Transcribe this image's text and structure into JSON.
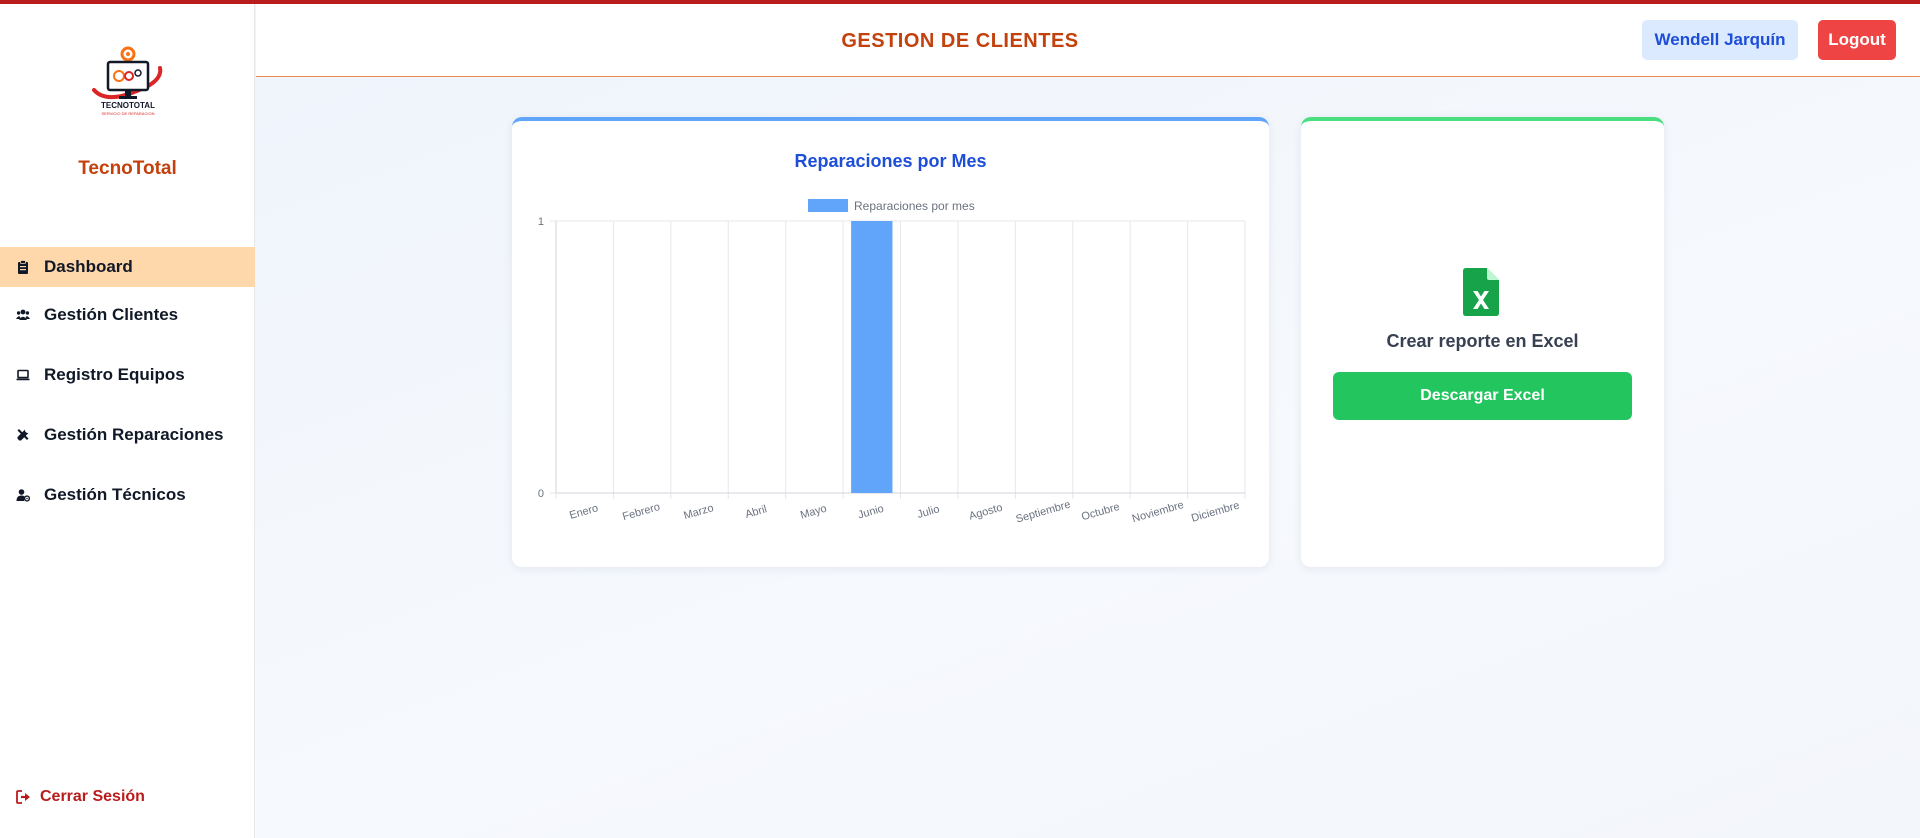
{
  "app": {
    "brand_name": "TecnoTotal",
    "logo_text": "TECNOTOTAL",
    "logo_subtext": "SERVICIO DE REPARACION"
  },
  "header": {
    "title": "GESTION DE CLIENTES",
    "user_name": "Wendell Jarquín",
    "logout_label": "Logout"
  },
  "sidebar": {
    "items": [
      {
        "label": "Dashboard",
        "icon": "clipboard-icon",
        "active": true
      },
      {
        "label": "Gestión Clientes",
        "icon": "users-icon",
        "active": false
      },
      {
        "label": "Registro Equipos",
        "icon": "laptop-icon",
        "active": false
      },
      {
        "label": "Gestión Reparaciones",
        "icon": "tools-icon",
        "active": false
      },
      {
        "label": "Gestión Técnicos",
        "icon": "user-gear-icon",
        "active": false
      }
    ],
    "logout_label": "Cerrar Sesión"
  },
  "chart_card": {
    "title": "Reparaciones por Mes"
  },
  "chart_data": {
    "type": "bar",
    "title": "Reparaciones por Mes",
    "categories": [
      "Enero",
      "Febrero",
      "Marzo",
      "Abril",
      "Mayo",
      "Junio",
      "Julio",
      "Agosto",
      "Septiembre",
      "Octubre",
      "Noviembre",
      "Diciembre"
    ],
    "series": [
      {
        "name": "Reparaciones por mes",
        "values": [
          0,
          0,
          0,
          0,
          0,
          1,
          0,
          0,
          0,
          0,
          0,
          0
        ],
        "color": "#60a5fa"
      }
    ],
    "yticks": [
      "0",
      "1"
    ],
    "ylim": [
      0,
      1
    ],
    "grid": true,
    "legend_position": "top"
  },
  "excel_card": {
    "title": "Crear reporte en Excel",
    "button_label": "Descargar Excel",
    "icon": "file-excel-icon"
  },
  "colors": {
    "accent": "#c2410c",
    "primary_blue": "#1d4ed8",
    "danger": "#ef4444",
    "success": "#22c55e",
    "active_nav": "#fed7aa"
  }
}
